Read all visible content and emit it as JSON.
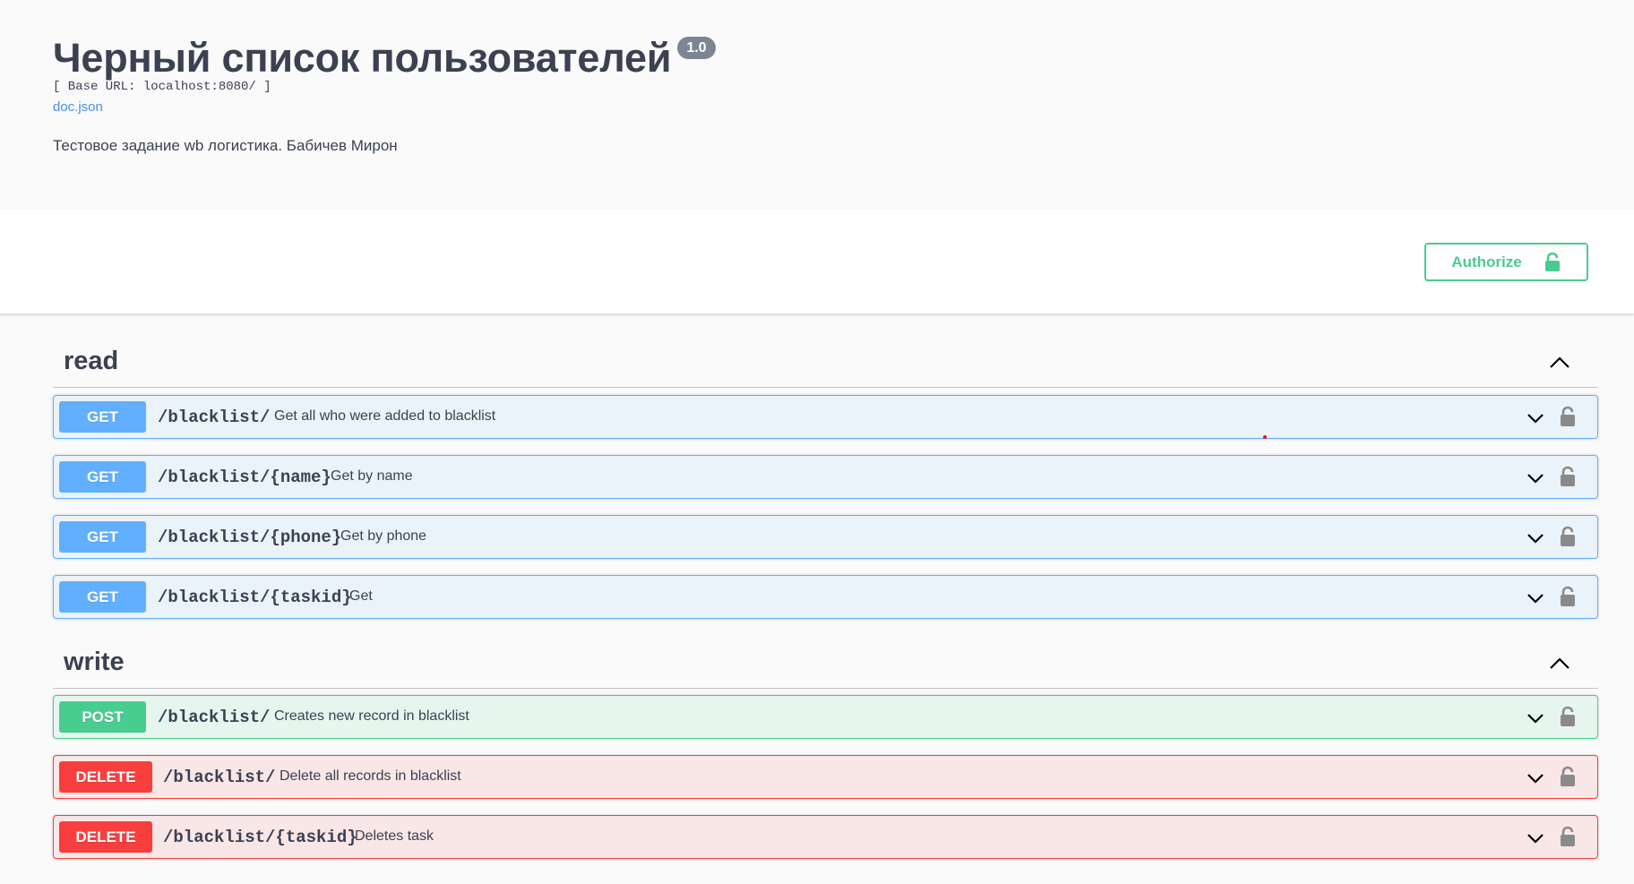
{
  "info": {
    "title": "Черный список пользователей",
    "version": "1.0",
    "base_url": "[ Base URL: localhost:8080/ ]",
    "doc_link": "doc.json",
    "description": "Тестовое задание wb логистика. Бабичев Мирон"
  },
  "scheme": {
    "authorize_label": "Authorize",
    "authorize_icon": "lock-open-icon"
  },
  "tags": [
    {
      "name": "read",
      "expanded": true,
      "operations": [
        {
          "method": "GET",
          "path": "/blacklist/",
          "summary": "Get all who were added to blacklist"
        },
        {
          "method": "GET",
          "path": "/blacklist/{name}",
          "summary": "Get by name"
        },
        {
          "method": "GET",
          "path": "/blacklist/{phone}",
          "summary": "Get by phone"
        },
        {
          "method": "GET",
          "path": "/blacklist/{taskid}",
          "summary": "Get"
        }
      ]
    },
    {
      "name": "write",
      "expanded": true,
      "operations": [
        {
          "method": "POST",
          "path": "/blacklist/",
          "summary": "Creates new record in blacklist"
        },
        {
          "method": "DELETE",
          "path": "/blacklist/",
          "summary": "Delete all records in blacklist"
        },
        {
          "method": "DELETE",
          "path": "/blacklist/{taskid}",
          "summary": "Deletes task"
        }
      ]
    }
  ],
  "colors": {
    "get": "#61affe",
    "post": "#49cc90",
    "delete": "#f93e3e",
    "text": "#3b4151",
    "link": "#4990e2"
  }
}
